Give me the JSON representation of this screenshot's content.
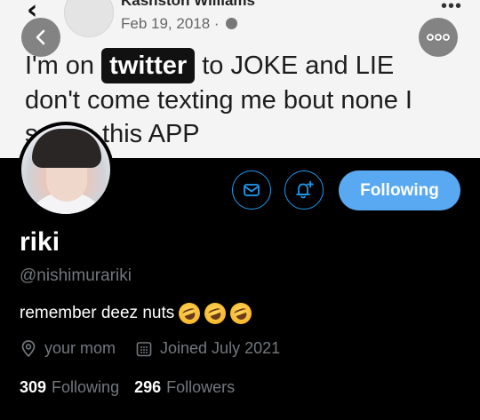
{
  "banner": {
    "author": "Kashston Williams",
    "date": "Feb 19, 2018 ·",
    "text_before": "I'm on",
    "text_highlight": "twitter",
    "text_after": "to JOKE and LIE",
    "text_line2": "don't come texting me bout none I",
    "text_line3_visible": "s      n this APP",
    "icons": [
      "back-chevron-icon",
      "globe-icon",
      "more-dots-icon"
    ]
  },
  "nav": {
    "back_icon": "chevron-left-icon",
    "more_icon": "more-horizontal-icon"
  },
  "profile": {
    "display_name": "riki",
    "handle": "@nishimurariki",
    "bio": "remember deez nuts",
    "bio_emoji": [
      "rolling-on-floor-laughing",
      "rolling-on-floor-laughing",
      "rolling-on-floor-laughing"
    ],
    "location": "your mom",
    "joined": "Joined July 2021",
    "following_count": "309",
    "following_label": "Following",
    "followers_count": "296",
    "followers_label": "Followers"
  },
  "actions": {
    "message_icon": "mail-icon",
    "notify_icon": "bell-plus-icon",
    "follow_label": "Following"
  },
  "colors": {
    "accent": "#1d9bf0",
    "follow_button": "#59a8f2",
    "muted_text": "#73787d",
    "background": "#000000"
  }
}
